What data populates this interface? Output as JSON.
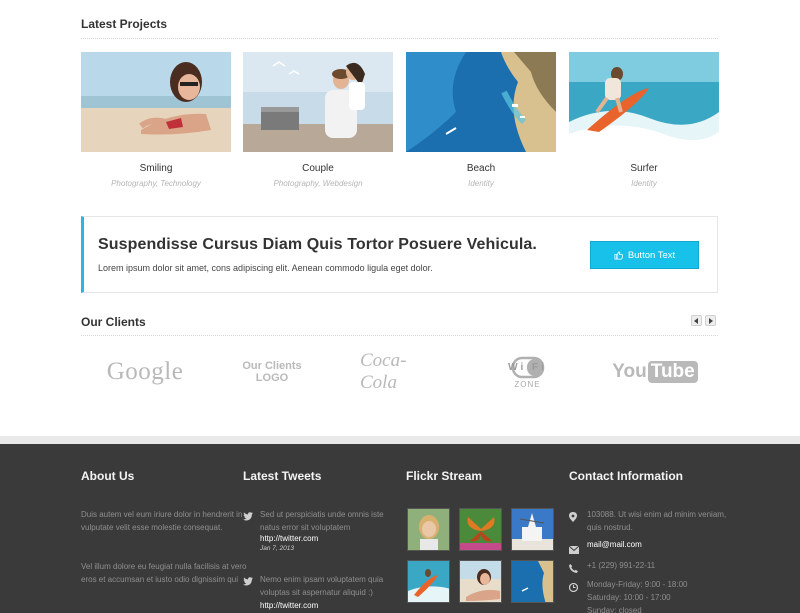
{
  "projects": {
    "title": "Latest Projects",
    "items": [
      {
        "title": "Smiling",
        "tags": "Photography, Technology"
      },
      {
        "title": "Couple",
        "tags": "Photography, Webdesign"
      },
      {
        "title": "Beach",
        "tags": "Identity"
      },
      {
        "title": "Surfer",
        "tags": "Identity"
      }
    ]
  },
  "callout": {
    "title": "Suspendisse Cursus Diam Quis Tortor Posuere Vehicula.",
    "text": "Lorem ipsum dolor sit amet, cons adipiscing elit. Aenean commodo ligula eget dolor.",
    "button": "Button Text",
    "accent": "#29b6e5",
    "button_color": "#17c1ea"
  },
  "clients": {
    "title": "Our Clients",
    "logos": {
      "google": "Google",
      "ourclients_line1": "Our Clients",
      "ourclients_line2": "LOGO",
      "coke": "Coca-Cola",
      "wifi": "Wi Fi",
      "wifi_zone": "ZONE",
      "youtube_you": "You",
      "youtube_tube": "Tube"
    }
  },
  "footer": {
    "about": {
      "title": "About Us",
      "p1": "Duis autem vel eum iriure dolor in hendrerit in vulputate velit esse molestie consequat.",
      "p2": "Vel illum dolore eu feugiat nulla facilisis at vero eros et accumsan et iusto odio dignissim qui"
    },
    "tweets": {
      "title": "Latest Tweets",
      "items": [
        {
          "text": "Sed ut perspiciatis unde omnis iste natus error sit voluptatem",
          "link": "http://twitter.com",
          "date": "Jan 7, 2013"
        },
        {
          "text": "Nemo enim ipsam voluptatem quia voluptas sit aspernatur aliquid :)",
          "link": "http://twitter.com"
        }
      ]
    },
    "flickr": {
      "title": "Flickr Stream"
    },
    "contact": {
      "title": "Contact Information",
      "address": "103088. Ut wisi enim ad minim veniam, quis nostrud.",
      "email": "mail@mail.com",
      "phone": "+1 (229) 991-22-11",
      "hours1": "Monday-Friday: 9:00 - 18:00",
      "hours2": "Saturday: 10:00 - 17:00",
      "hours3": "Sunday: closed"
    },
    "background": "#3a3a3a"
  }
}
